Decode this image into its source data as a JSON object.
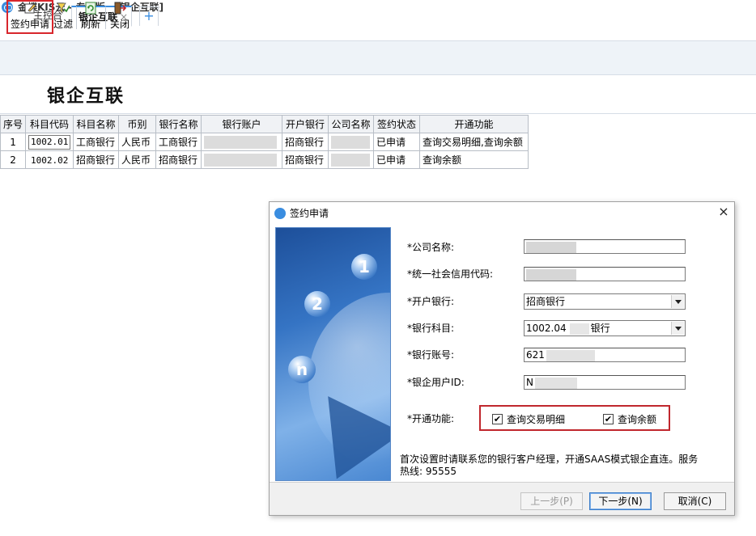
{
  "app": {
    "title": "金蝶KIS云 - 专业版 - [银企互联]",
    "tabs": [
      {
        "label": "主控台"
      },
      {
        "label": "银企互联",
        "close": "×"
      }
    ],
    "add_tab": "+"
  },
  "toolbar": {
    "sign": "签约申请",
    "filter": "过滤",
    "refresh": "刷新",
    "close": "关闭"
  },
  "page": {
    "title": "银企互联"
  },
  "table": {
    "headers": [
      "序号",
      "科目代码",
      "科目名称",
      "币别",
      "银行名称",
      "银行账户",
      "开户银行",
      "公司名称",
      "签约状态",
      "开通功能"
    ],
    "rows": [
      {
        "no": "1",
        "code": "1002.01",
        "name": "工商银行",
        "currency": "人民币",
        "bank": "工商银行",
        "account": "",
        "open_bank": "招商银行",
        "company": "",
        "status": "已申请",
        "func": "查询交易明细,查询余额"
      },
      {
        "no": "2",
        "code": "1002.02",
        "name": "招商银行",
        "currency": "人民币",
        "bank": "招商银行",
        "account": "",
        "open_bank": "招商银行",
        "company": "",
        "status": "已申请",
        "func": "查询余额"
      }
    ]
  },
  "dialog": {
    "title": "签约申请",
    "close": "×",
    "art": {
      "c1": "1",
      "c2": "2",
      "cn": "n"
    },
    "fields": {
      "company_label": "*公司名称:",
      "credit_label": "*统一社会信用代码:",
      "open_bank_label": "*开户银行:",
      "open_bank_value": "招商银行",
      "subject_label": "*银行科目:",
      "subject_value_code": "1002.04",
      "subject_value_name": "银行",
      "account_label": "*银行账号:",
      "account_value": "621",
      "userid_label": "*银企用户ID:",
      "userid_value": "N",
      "func_label": "*开通功能:",
      "func_opt1": "查询交易明细",
      "func_opt2": "查询余额",
      "check_mark": "✔"
    },
    "note": "首次设置时请联系您的银行客户经理，开通SAAS模式银企直连。服务热线: 95555",
    "buttons": {
      "prev": "上一步(P)",
      "next": "下一步(N)",
      "cancel": "取消(C)"
    }
  }
}
